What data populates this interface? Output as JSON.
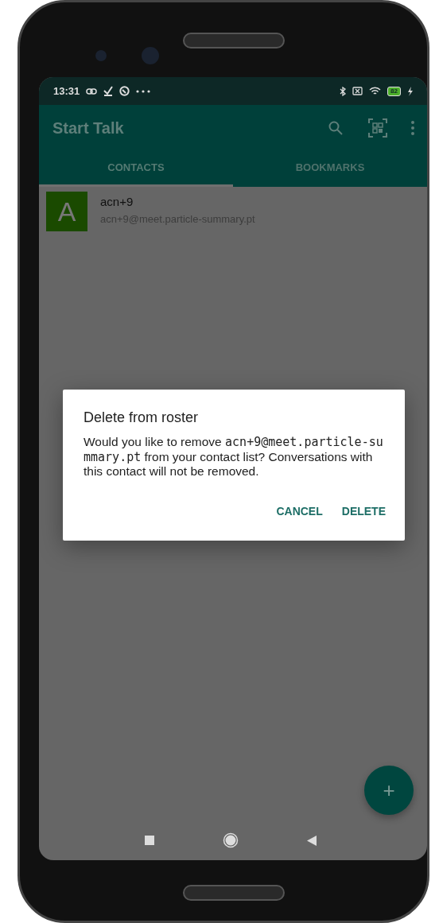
{
  "status_bar": {
    "time": "13:31",
    "battery": "82"
  },
  "app_bar": {
    "title": "Start Talk"
  },
  "tabs": [
    {
      "label": "CONTACTS",
      "selected": true
    },
    {
      "label": "BOOKMARKS",
      "selected": false
    }
  ],
  "contacts": [
    {
      "initial": "A",
      "name": "acn+9",
      "address": "acn+9@meet.particle-summary.pt"
    }
  ],
  "dialog": {
    "title": "Delete from roster",
    "message": [
      {
        "kind": "plain",
        "text": "Would you like to remove "
      },
      {
        "kind": "mono",
        "text": "acn+9@meet.particle-summary.pt"
      },
      {
        "kind": "plain",
        "text": " from your contact list? Conversations with this contact will not be removed."
      }
    ],
    "buttons": [
      "CANCEL",
      "DELETE"
    ]
  },
  "fab": {
    "label": "+"
  }
}
